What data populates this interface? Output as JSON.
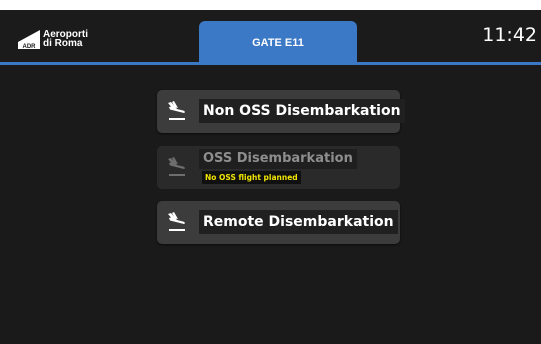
{
  "header": {
    "logo_line1": "Aeroporti",
    "logo_line2": "di Roma",
    "logo_mark": "ADR",
    "gate_tab_label": "GATE E11",
    "clock": "11:42"
  },
  "menu": {
    "items": [
      {
        "label": "Non OSS Disembarkation",
        "icon": "plane-landing-icon",
        "enabled": true
      },
      {
        "label": "OSS Disembarkation",
        "sublabel": "No OSS flight planned",
        "icon": "plane-landing-icon",
        "enabled": false
      },
      {
        "label": "Remote Disembarkation",
        "icon": "plane-landing-icon",
        "enabled": true
      }
    ]
  },
  "colors": {
    "background": "#1a1a1a",
    "accent": "#3b78c6",
    "button": "#3c3c3c",
    "warning_text": "#f2e600"
  }
}
